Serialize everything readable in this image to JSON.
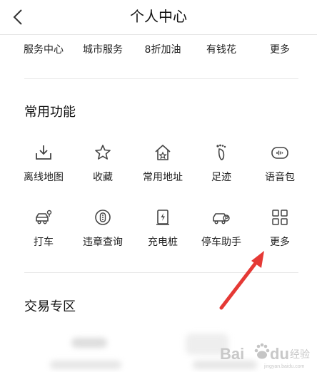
{
  "header": {
    "title": "个人中心",
    "back_icon": "chevron-left-icon"
  },
  "services": [
    "服务中心",
    "城市服务",
    "8折加油",
    "有钱花",
    "更多"
  ],
  "common": {
    "title": "常用功能",
    "items": [
      {
        "label": "离线地图",
        "icon": "download-tray-icon"
      },
      {
        "label": "收藏",
        "icon": "star-icon"
      },
      {
        "label": "常用地址",
        "icon": "home-star-icon"
      },
      {
        "label": "足迹",
        "icon": "footprint-icon"
      },
      {
        "label": "语音包",
        "icon": "voice-pack-icon"
      },
      {
        "label": "打车",
        "icon": "taxi-icon"
      },
      {
        "label": "违章查询",
        "icon": "violation-query-icon"
      },
      {
        "label": "充电桩",
        "icon": "charging-pile-icon"
      },
      {
        "label": "停车助手",
        "icon": "parking-car-icon"
      },
      {
        "label": "更多",
        "icon": "grid-icon"
      }
    ]
  },
  "trade": {
    "title": "交易专区"
  },
  "watermark": {
    "brand": "Bai",
    "du": "du",
    "text": "经验",
    "url": "jingyan.baidu.com"
  },
  "colors": {
    "icon": "#444444",
    "arrow": "#e53935",
    "divider": "#e8e8e8"
  }
}
